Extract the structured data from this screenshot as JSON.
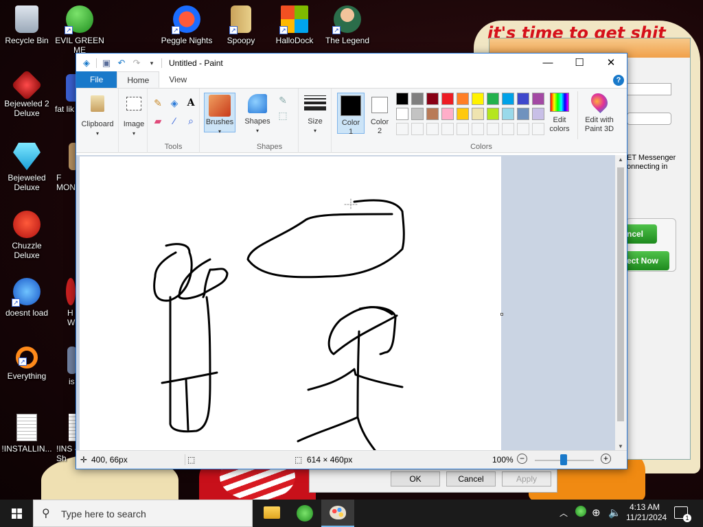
{
  "desktop": {
    "bg_text": "it's time to get shit",
    "icons": [
      {
        "label": "Recycle Bin",
        "icon": "recycle-bin-icon"
      },
      {
        "label": "EVIL GREEN ME",
        "icon": "messenger-icon"
      },
      {
        "label": "Peggle Nights",
        "icon": "peggle-icon"
      },
      {
        "label": "Spoopy",
        "icon": "spoopy-icon"
      },
      {
        "label": "HalloDock",
        "icon": "windows-logo-icon"
      },
      {
        "label": "The Legend",
        "icon": "legend-icon"
      },
      {
        "label": "Bejeweled 2 Deluxe",
        "icon": "bejeweled2-icon"
      },
      {
        "label": "fat lik",
        "icon": "app-icon"
      },
      {
        "label": "Bejeweled Deluxe",
        "icon": "bejeweled-icon"
      },
      {
        "label": "F MON",
        "icon": "app-icon"
      },
      {
        "label": "Chuzzle Deluxe",
        "icon": "chuzzle-icon"
      },
      {
        "label": "doesnt load",
        "icon": "thunderbird-icon"
      },
      {
        "label": "H W",
        "icon": "app-icon"
      },
      {
        "label": "Everything",
        "icon": "everything-search-icon"
      },
      {
        "label": "is",
        "icon": "app-icon"
      },
      {
        "label": "!INSTALLIN...",
        "icon": "document-icon"
      },
      {
        "label": "!INS - Sh",
        "icon": "document-icon"
      }
    ]
  },
  "bgwindow": {
    "text1": "ET Messenger",
    "text2": "onnecting in",
    "btn_cancel": "ncel",
    "btn_connect": "ect Now",
    "ok": "OK",
    "cancel": "Cancel",
    "apply": "Apply"
  },
  "paint": {
    "title": "Untitled - Paint",
    "tabs": {
      "file": "File",
      "home": "Home",
      "view": "View"
    },
    "help": "?",
    "groups": {
      "clipboard": "Clipboard",
      "image": "Image",
      "tools": "Tools",
      "brushes": "Brushes",
      "shapes_btn": "Shapes",
      "shapes": "Shapes",
      "size": "Size",
      "color1": "Color 1",
      "color2": "Color 2",
      "colors": "Colors",
      "edit_colors": "Edit colors",
      "edit_paint3d": "Edit with Paint 3D"
    },
    "palette_row1": [
      "#000000",
      "#7f7f7f",
      "#880015",
      "#ed1c24",
      "#ff7f27",
      "#fff200",
      "#22b14c",
      "#00a2e8",
      "#3f48cc",
      "#a349a4"
    ],
    "palette_row2": [
      "#ffffff",
      "#c3c3c3",
      "#b97a57",
      "#ffaec9",
      "#ffc90e",
      "#efe4b0",
      "#b5e61d",
      "#99d9ea",
      "#7092be",
      "#c8bfe7"
    ],
    "status": {
      "cursor_pos": "400, 66px",
      "canvas_size": "614 × 460px",
      "zoom": "100%"
    }
  },
  "taskbar": {
    "search_placeholder": "Type here to search",
    "time": "4:13 AM",
    "date": "11/21/2024",
    "notif_count": "1"
  }
}
